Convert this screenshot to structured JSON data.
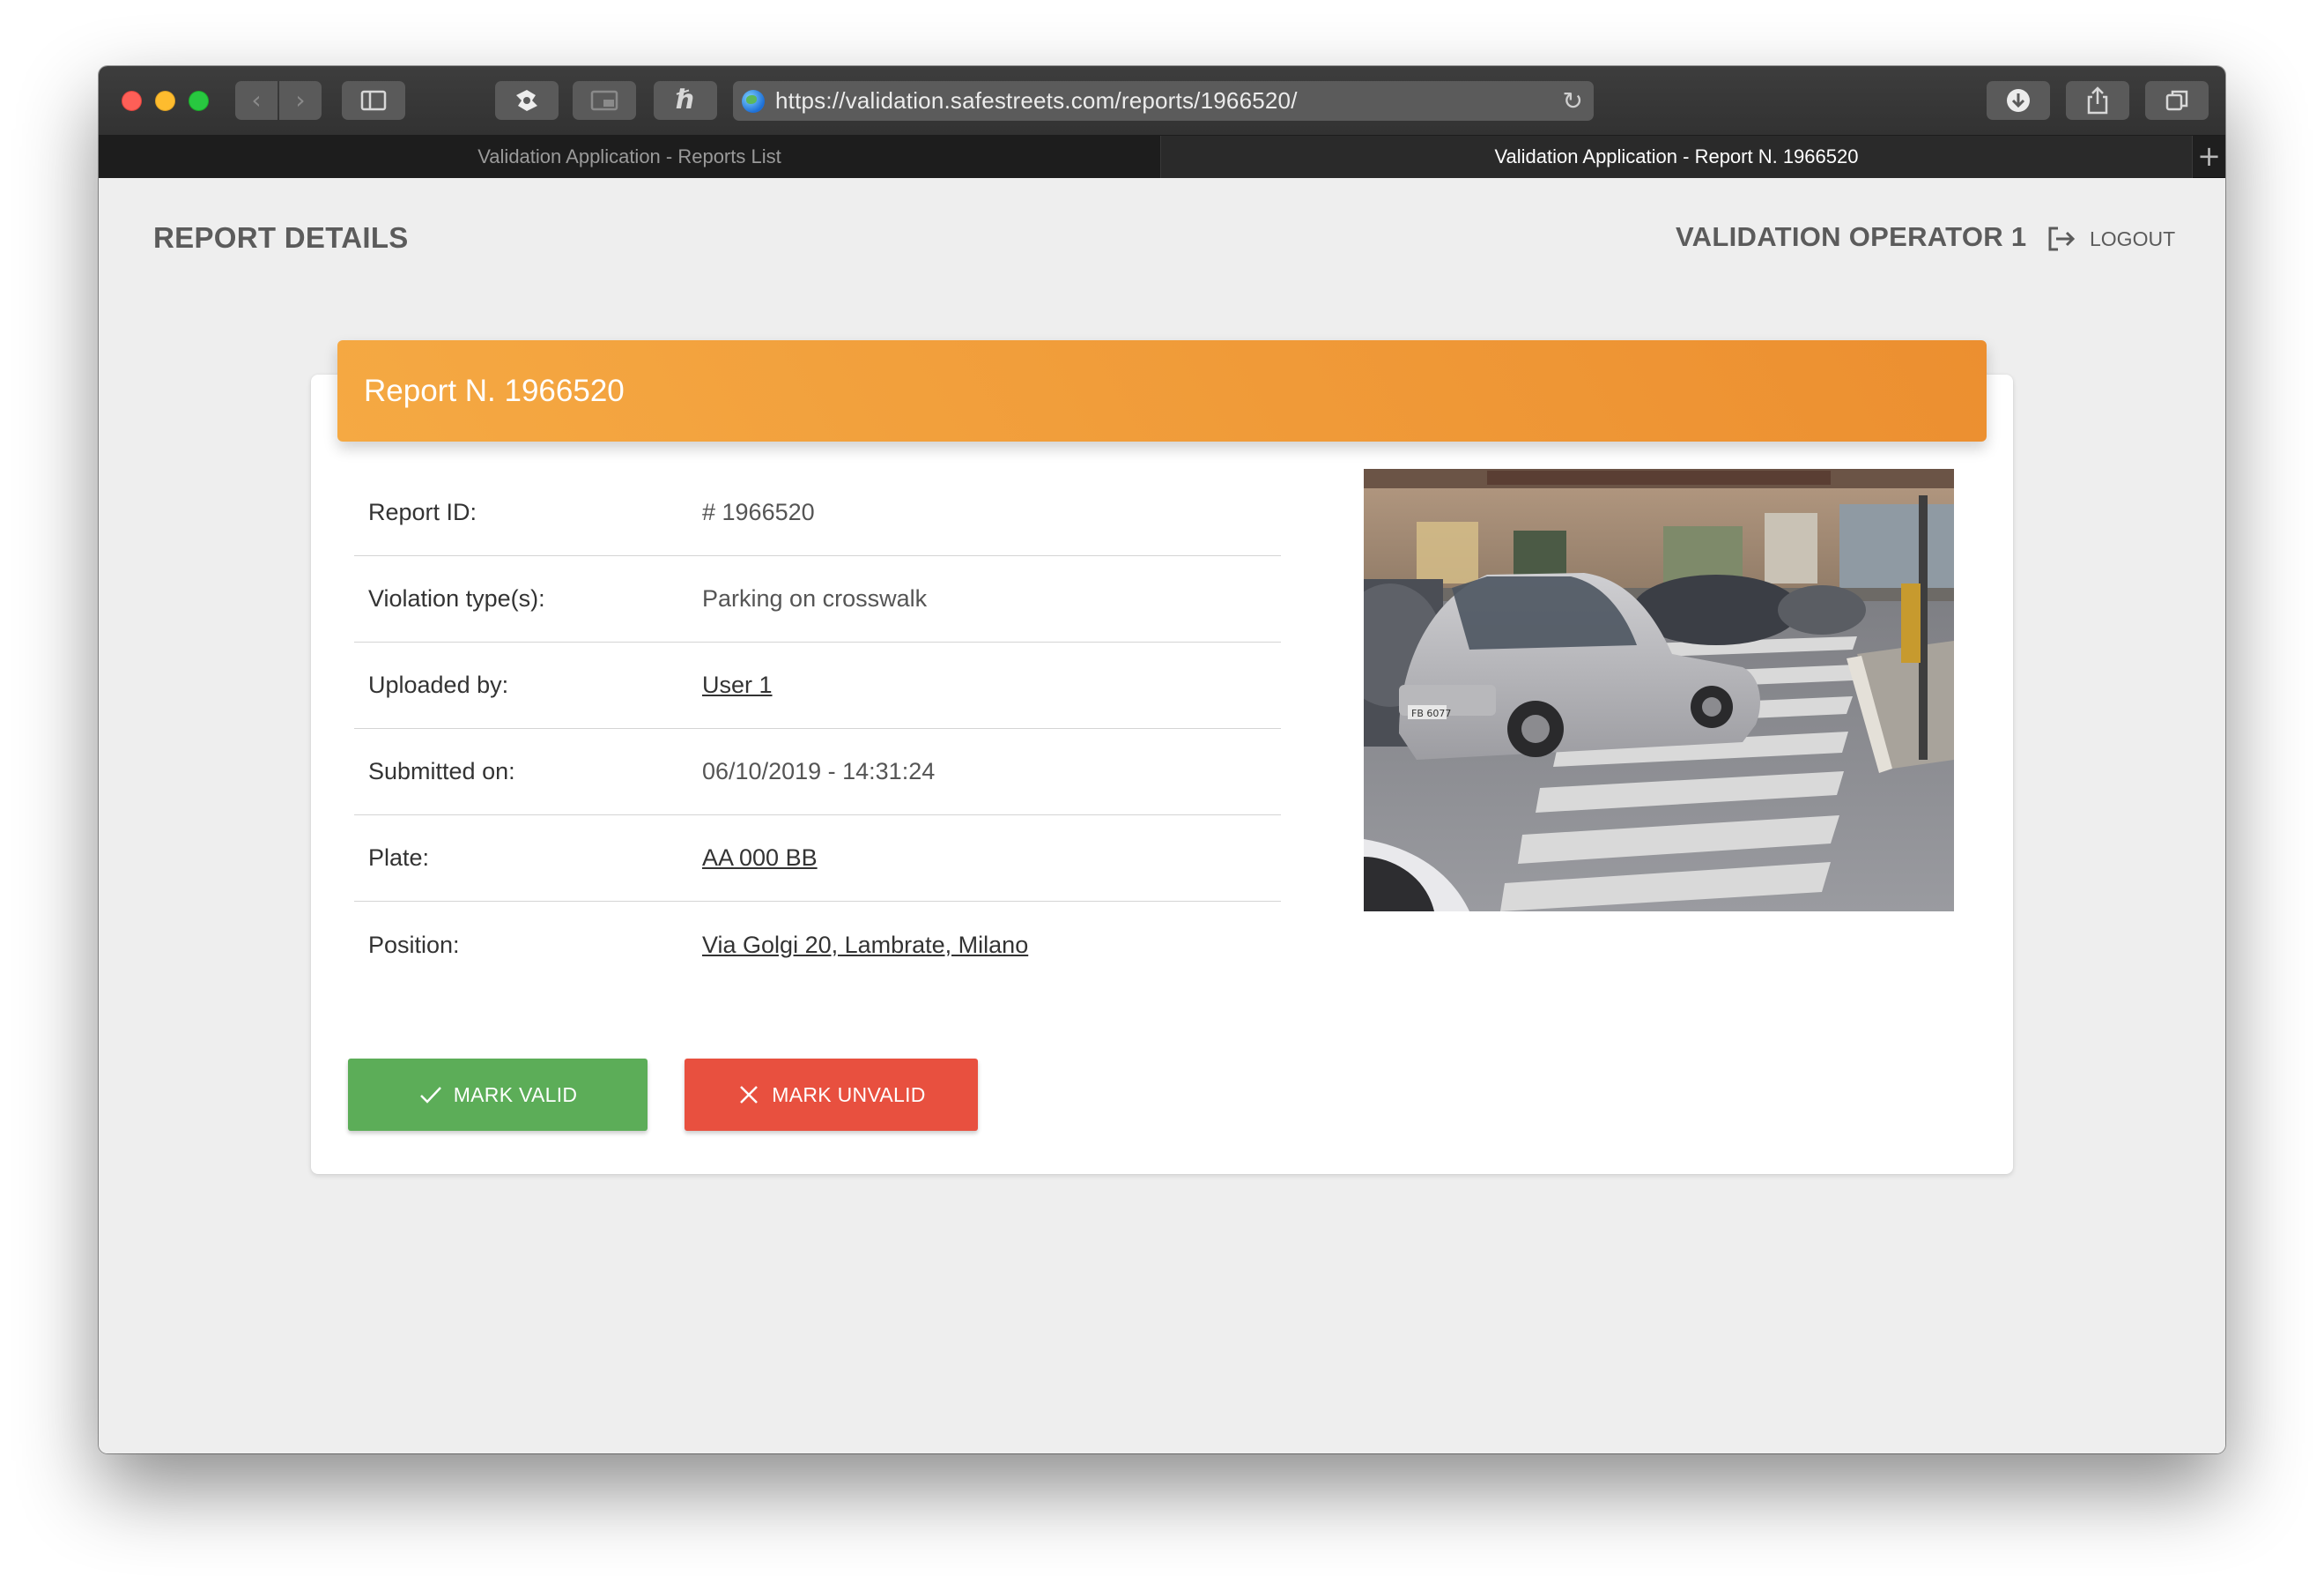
{
  "browser": {
    "url": "https://validation.safestreets.com/reports/1966520/",
    "tabs": [
      {
        "label": "Validation Application - Reports List",
        "active": false
      },
      {
        "label": "Validation Application - Report N. 1966520",
        "active": true
      }
    ]
  },
  "header": {
    "title": "REPORT DETAILS",
    "operator": "VALIDATION OPERATOR 1",
    "logout_label": "LOGOUT"
  },
  "report": {
    "heading": "Report N. 1966520",
    "fields": [
      {
        "label": "Report ID:",
        "value": "# 1966520"
      },
      {
        "label": "Violation type(s):",
        "value": "Parking on crosswalk"
      },
      {
        "label": "Uploaded by:",
        "value": "User 1"
      },
      {
        "label": "Submitted on:",
        "value": "06/10/2019 - 14:31:24"
      },
      {
        "label": "Plate:",
        "value": "AA 000 BB"
      },
      {
        "label": "Position:",
        "value": "Via Golgi 20, Lambrate, Milano"
      }
    ],
    "photo_plate": "FB 6077"
  },
  "actions": {
    "valid_label": "MARK VALID",
    "unvalid_label": "MARK UNVALID"
  },
  "colors": {
    "accent_orange": "#ef9a3a",
    "valid_green": "#5cad58",
    "unvalid_red": "#e8503f"
  }
}
